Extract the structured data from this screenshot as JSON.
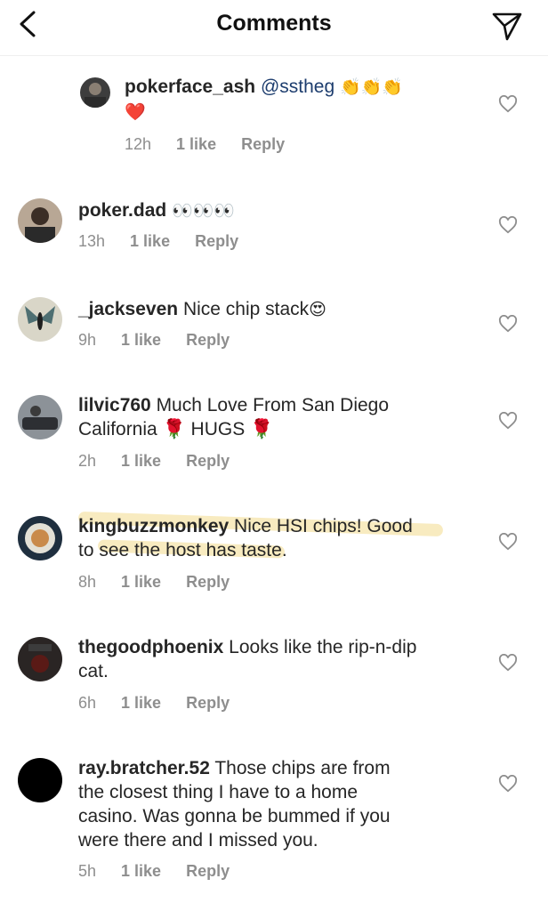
{
  "header": {
    "title": "Comments"
  },
  "comments": [
    {
      "username": "pokerface_ash",
      "mention": "@sstheg",
      "emoji": "👏👏👏",
      "emoji_line2": "❤️",
      "time": "12h",
      "likes": "1 like",
      "reply": "Reply"
    },
    {
      "username": "poker.dad",
      "text": "",
      "emoji": "👀👀👀",
      "time": "13h",
      "likes": "1 like",
      "reply": "Reply"
    },
    {
      "username": "_jackseven",
      "text": " Nice chip stack",
      "emoji": "😍",
      "time": "9h",
      "likes": "1 like",
      "reply": "Reply"
    },
    {
      "username": "lilvic760",
      "text": " Much Love From San Diego",
      "text_line2": "California 🌹 HUGS 🌹",
      "time": "2h",
      "likes": "1 like",
      "reply": "Reply"
    },
    {
      "username": "kingbuzzmonkey",
      "text": " Nice HSI chips! Good",
      "text_line2": "to see the host has taste.",
      "time": "8h",
      "likes": "1 like",
      "reply": "Reply"
    },
    {
      "username": "thegoodphoenix",
      "text": " Looks like the rip-n-dip",
      "text_line2": "cat.",
      "time": "6h",
      "likes": "1 like",
      "reply": "Reply"
    },
    {
      "username": "ray.bratcher.52",
      "text": " Those chips are from",
      "text_line2": "the closest thing I have to a home",
      "text_line3": "casino. Was gonna be bummed if you",
      "text_line4": "were there and I missed you.",
      "time": "5h",
      "likes": "1 like",
      "reply": "Reply"
    }
  ]
}
